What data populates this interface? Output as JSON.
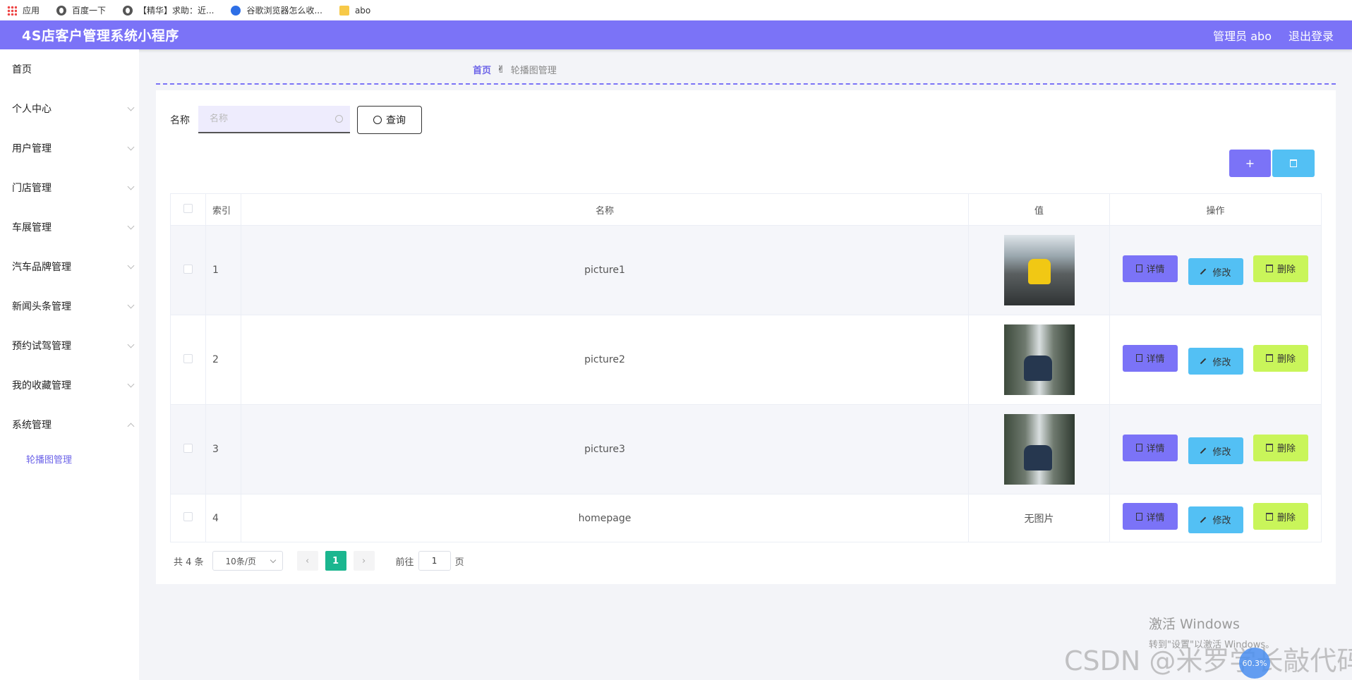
{
  "bookmarks": [
    {
      "label": "应用",
      "icon": "apps-icon"
    },
    {
      "label": "百度一下",
      "icon": "globe-icon"
    },
    {
      "label": "【精华】求助：近...",
      "icon": "globe-icon"
    },
    {
      "label": "谷歌浏览器怎么收...",
      "icon": "paw-icon"
    },
    {
      "label": "abo",
      "icon": "folder-icon"
    }
  ],
  "header": {
    "title": "4S店客户管理系统小程序",
    "user": "管理员 abo",
    "logout": "退出登录",
    "color": "#7b73f7"
  },
  "sidebar": {
    "items": [
      {
        "label": "首页"
      },
      {
        "label": "个人中心"
      },
      {
        "label": "用户管理"
      },
      {
        "label": "门店管理"
      },
      {
        "label": "车展管理"
      },
      {
        "label": "汽车品牌管理"
      },
      {
        "label": "新闻头条管理"
      },
      {
        "label": "预约试驾管理"
      },
      {
        "label": "我的收藏管理"
      },
      {
        "label": "系统管理"
      }
    ],
    "sub_item": "轮播图管理"
  },
  "breadcrumb": {
    "home": "首页",
    "current": "轮播图管理"
  },
  "search": {
    "label": "名称",
    "placeholder": "名称",
    "value": "",
    "button": "查询"
  },
  "toolbar": {
    "add": "+"
  },
  "table": {
    "headers": {
      "index": "索引",
      "name": "名称",
      "value": "值",
      "ops": "操作"
    },
    "rows": [
      {
        "index": "1",
        "name": "picture1",
        "value": "",
        "image": "thumb1"
      },
      {
        "index": "2",
        "name": "picture2",
        "value": "",
        "image": "thumb2"
      },
      {
        "index": "3",
        "name": "picture3",
        "value": "",
        "image": "thumb2"
      },
      {
        "index": "4",
        "name": "homepage",
        "value": "无图片",
        "image": ""
      }
    ],
    "ops": {
      "detail": "详情",
      "edit": "修改",
      "delete": "删除"
    }
  },
  "pager": {
    "total": "共 4 条",
    "page_size": "10条/页",
    "prev": "‹",
    "next": "›",
    "current": "1",
    "goto_label": "前往",
    "goto_value": "1",
    "page_suffix": "页"
  },
  "watermark": {
    "win_line1": "激活 Windows",
    "win_line2": "转到\"设置\"以激活 Windows。",
    "csdn": "CSDN @米罗学长敲代码",
    "circle": "60.3%"
  }
}
